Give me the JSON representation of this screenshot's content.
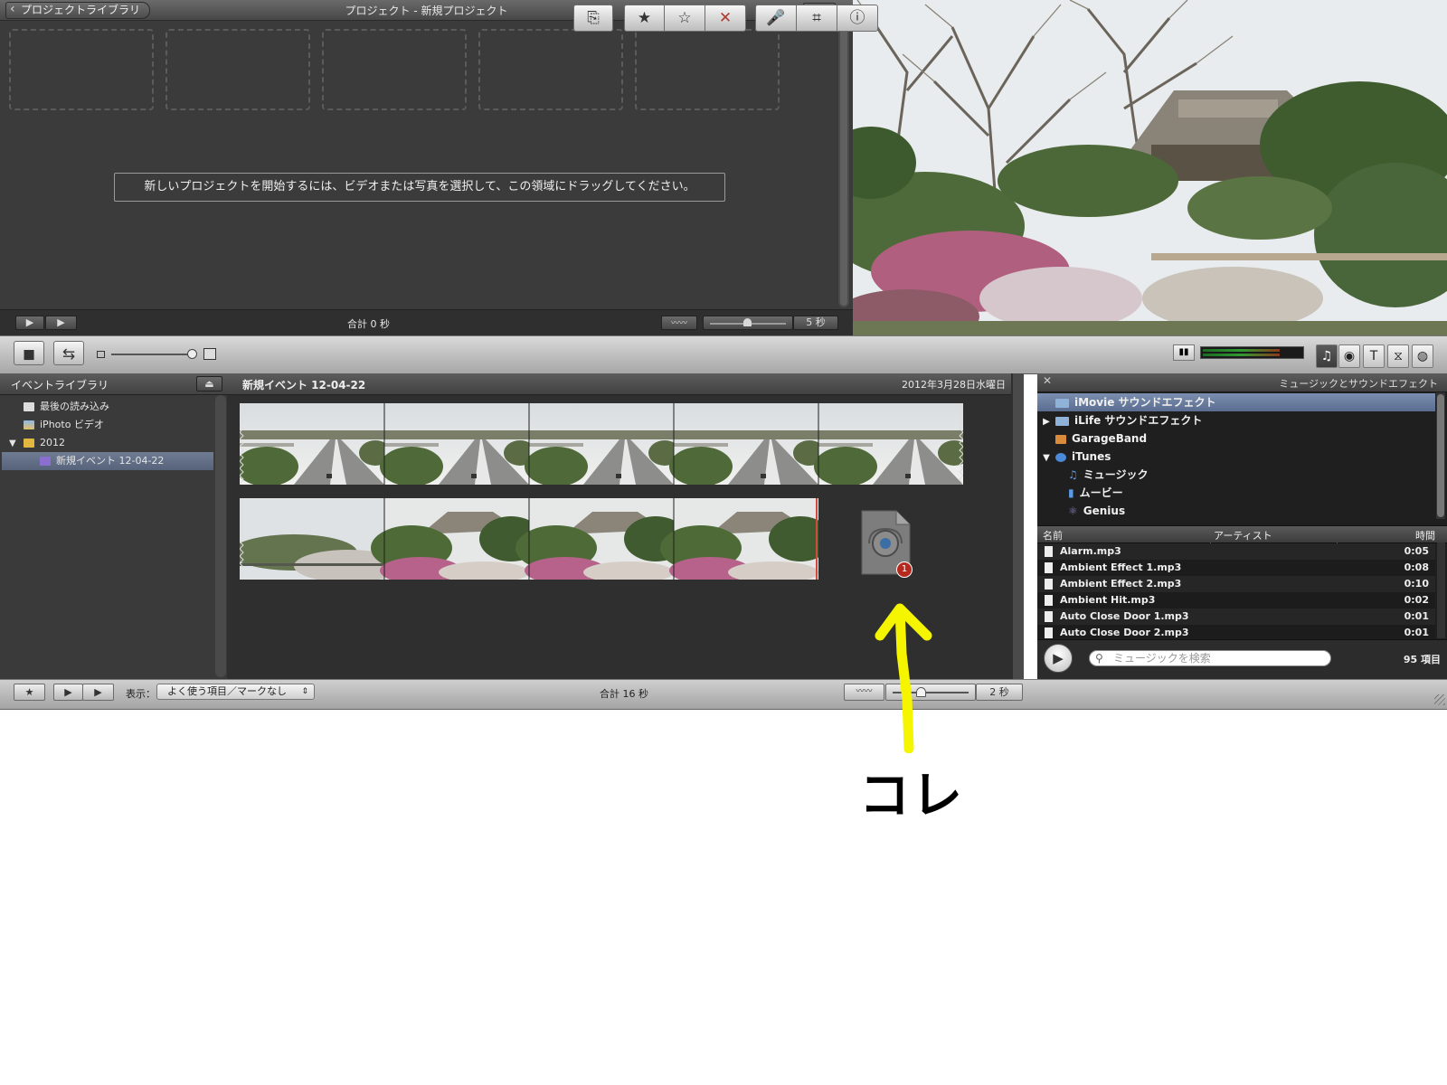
{
  "project": {
    "back_label": "プロジェクトライブラリ",
    "title": "プロジェクト - 新規プロジェクト",
    "menu_glyph": "▪▪▪",
    "hint": "新しいプロジェクトを開始するには、ビデオまたは写真を選択して、この領域にドラッグしてください。",
    "total": "合計 0 秒",
    "zoom_value": "5 秒"
  },
  "event_library": {
    "title": "イベントライブラリ",
    "items": [
      {
        "label": "最後の読み込み",
        "arrow": ""
      },
      {
        "label": "iPhoto ビデオ",
        "arrow": ""
      },
      {
        "label": "2012",
        "arrow": "▼"
      },
      {
        "label": "新規イベント 12-04-22",
        "arrow": ""
      }
    ]
  },
  "event_browser": {
    "title": "新規イベント 12-04-22",
    "date": "2012年3月28日水曜日",
    "badge_count": "1"
  },
  "music": {
    "close_glyph": "✕",
    "title": "ミュージックとサウンドエフェクト",
    "tree": [
      {
        "label": "iMovie サウンドエフェクト",
        "arrow": ""
      },
      {
        "label": "iLife サウンドエフェクト",
        "arrow": "▶"
      },
      {
        "label": "GarageBand",
        "arrow": ""
      },
      {
        "label": "iTunes",
        "arrow": "▼"
      },
      {
        "label": "ミュージック",
        "arrow": ""
      },
      {
        "label": "ムービー",
        "arrow": ""
      },
      {
        "label": "Genius",
        "arrow": ""
      }
    ],
    "columns": {
      "name": "名前",
      "artist": "アーティスト",
      "time": "時間"
    },
    "rows": [
      {
        "name": "Alarm.mp3",
        "artist": "",
        "time": "0:05"
      },
      {
        "name": "Ambient Effect 1.mp3",
        "artist": "",
        "time": "0:08"
      },
      {
        "name": "Ambient Effect 2.mp3",
        "artist": "",
        "time": "0:10"
      },
      {
        "name": "Ambient Hit.mp3",
        "artist": "",
        "time": "0:02"
      },
      {
        "name": "Auto Close Door 1.mp3",
        "artist": "",
        "time": "0:01"
      },
      {
        "name": "Auto Close Door 2.mp3",
        "artist": "",
        "time": "0:01"
      }
    ],
    "search_placeholder": "ミュージックを検索",
    "count": "95 項目"
  },
  "bottom": {
    "show_label": "表示：",
    "filter_value": "よく使う項目／マークなし",
    "total": "合計 16 秒",
    "zoom_value": "2 秒"
  },
  "annotation": {
    "text": "コレ",
    "arrow_color": "#f5f500"
  },
  "colors": {
    "selection": "#5a6d90",
    "reject": "#c0392b"
  }
}
